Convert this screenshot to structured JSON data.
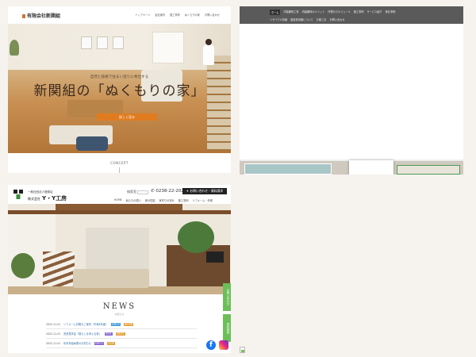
{
  "panel_a": {
    "logo": "有限会社新関組",
    "nav": [
      "トップページ",
      "会社案内",
      "施工事例",
      "ぬくもりの家",
      "お問い合わせ"
    ],
    "subcopy": "自然と技術で住まい造りに奉仕する",
    "main_copy": "新関組の「ぬくもりの家」",
    "button": "詳しく見る",
    "concept": "CONCEPT",
    "colors": {
      "accent": "#e07c1f"
    }
  },
  "panel_b": {
    "nav_row1": [
      "ホーム",
      "内装解体工事",
      "内装解体のメリット",
      "作業のスケジュール",
      "施工事例",
      "サービス紹介",
      "家仕事例"
    ],
    "nav_row2": [
      "リサイクル情報",
      "施設長情報について",
      "お客さま",
      "お問い合わせ"
    ],
    "active": "ホーム"
  },
  "panel_c": {
    "logo_small": "一般社団法人登録店",
    "logo_prefix": "株式会社",
    "logo_main": "Y・Y工房",
    "search_label": "検索窓",
    "tel": "0238-22-2022",
    "contact_button": "お問い合わせ・資料請求",
    "nav": [
      "HOME",
      "私たちの想い",
      "家の性能",
      "家作りの流れ",
      "施工事例",
      "リフォーム・外構"
    ],
    "news_title": "NEWS",
    "news_sub": "お知らせ",
    "news": [
      {
        "date": "2022.11.01",
        "title": "リフォーム対策のご案内（令和4年度）",
        "tags": [
          "お知らせ",
          "施工事例"
        ]
      },
      {
        "date": "2022.11.01",
        "title": "完成見学会「暮らしを考える家」",
        "tags": [
          "見学会",
          "お知らせ"
        ]
      },
      {
        "date": "2022.11.01",
        "title": "年末年始休業のお知らせ",
        "tags": [
          "お知らせ",
          "その他"
        ]
      }
    ],
    "side_tabs": [
      "お問い合わせ",
      "資料請求"
    ],
    "colors": {
      "tag1": "#48a0d8",
      "tag2": "#e6a23c",
      "tag3": "#8b6bd1",
      "side": "#6cbf58"
    }
  }
}
